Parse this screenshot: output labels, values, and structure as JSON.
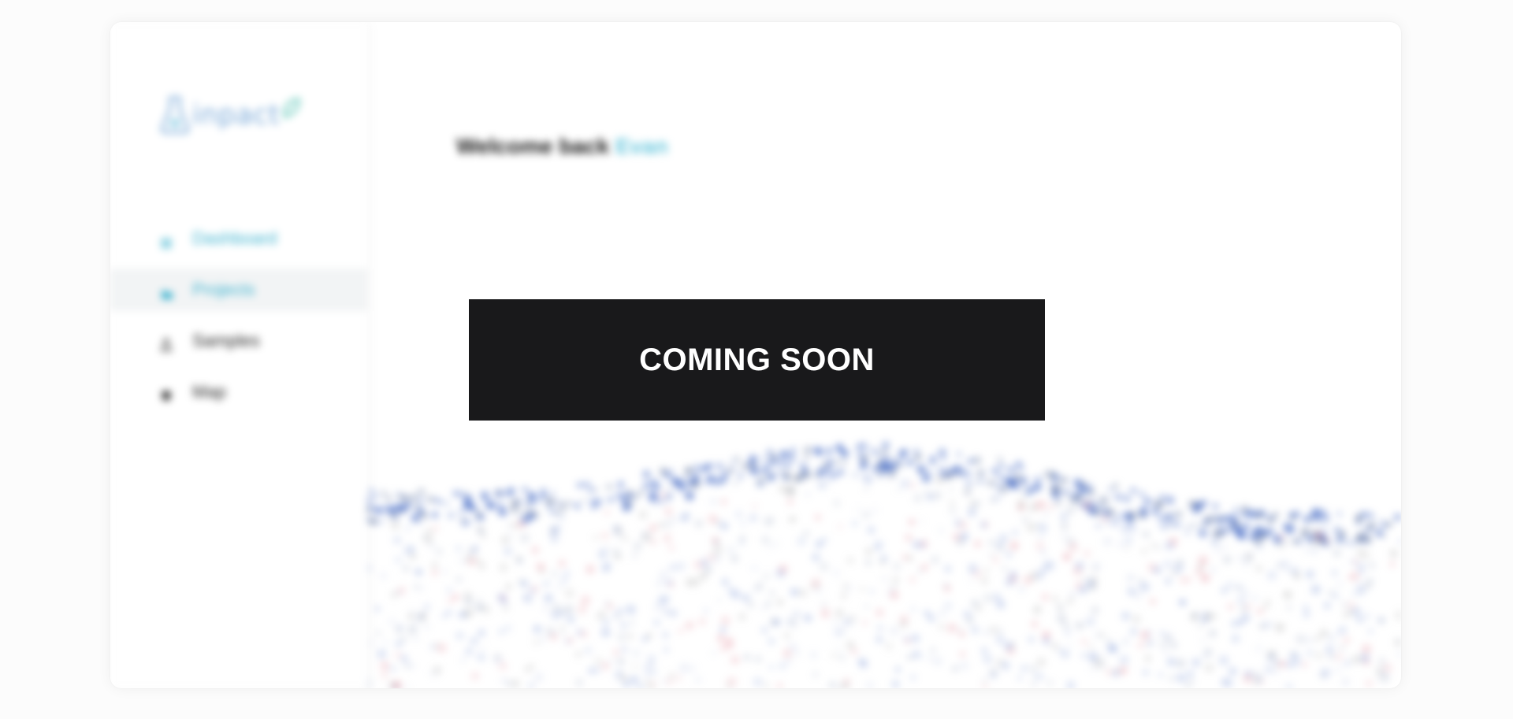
{
  "logo": {
    "icon": "flask-icon",
    "text": "inpact"
  },
  "sidebar": {
    "items": [
      {
        "label": "Dashboard",
        "icon": "grid-icon",
        "color": "#3fb3cf"
      },
      {
        "label": "Projects",
        "icon": "folder-icon",
        "color": "#3fb3cf",
        "selected": true
      },
      {
        "label": "Samples",
        "icon": "sample-icon"
      },
      {
        "label": "Map",
        "icon": "map-icon"
      }
    ]
  },
  "main": {
    "welcome_prefix": "Welcome back",
    "welcome_name": "Evan",
    "banner_label": "COMING SOON"
  },
  "colors": {
    "accent": "#3fb3cf",
    "banner_bg": "#19191b",
    "art_blue": "#4a6fc8",
    "art_red": "#d75a6e"
  }
}
